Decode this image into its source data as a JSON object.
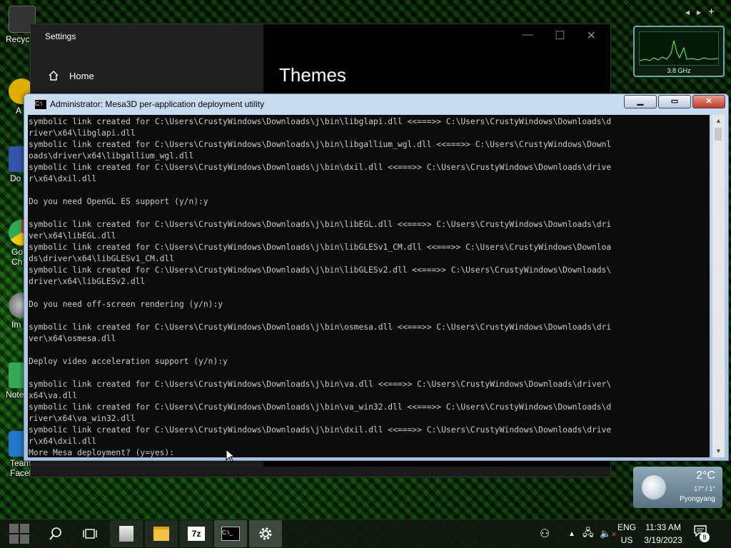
{
  "desktop": {
    "icons": [
      {
        "label": "Recyc",
        "color": "#2c2c2c"
      },
      {
        "label": "A",
        "color": "#e0b000"
      },
      {
        "label": "Do",
        "color": "#3355aa"
      },
      {
        "label": "Go\nCh",
        "color": "#dd3333"
      },
      {
        "label": "Im",
        "color": "#777777"
      },
      {
        "label": "Note",
        "color": "#33aa55"
      },
      {
        "label": "Team\nFacebo...",
        "color": "#2277cc"
      }
    ]
  },
  "cpu_gadget": {
    "label": "3.8 GHz"
  },
  "weather": {
    "temp": "2°C",
    "range": "17° / 1°",
    "city": "Pyongyang"
  },
  "settings": {
    "title": "Settings",
    "home_label": "Home",
    "page_title": "Themes"
  },
  "console": {
    "title": "Administrator:  Mesa3D per-application deployment utility",
    "lines": [
      "symbolic link created for C:\\Users\\CrustyWindows\\Downloads\\j\\bin\\libglapi.dll <<===>> C:\\Users\\CrustyWindows\\Downloads\\d",
      "river\\x64\\libglapi.dll",
      "symbolic link created for C:\\Users\\CrustyWindows\\Downloads\\j\\bin\\libgallium_wgl.dll <<===>> C:\\Users\\CrustyWindows\\Downl",
      "oads\\driver\\x64\\libgallium_wgl.dll",
      "symbolic link created for C:\\Users\\CrustyWindows\\Downloads\\j\\bin\\dxil.dll <<===>> C:\\Users\\CrustyWindows\\Downloads\\drive",
      "r\\x64\\dxil.dll",
      "",
      "Do you need OpenGL ES support (y/n):y",
      "",
      "symbolic link created for C:\\Users\\CrustyWindows\\Downloads\\j\\bin\\libEGL.dll <<===>> C:\\Users\\CrustyWindows\\Downloads\\dri",
      "ver\\x64\\libEGL.dll",
      "symbolic link created for C:\\Users\\CrustyWindows\\Downloads\\j\\bin\\libGLESv1_CM.dll <<===>> C:\\Users\\CrustyWindows\\Downloa",
      "ds\\driver\\x64\\libGLESv1_CM.dll",
      "symbolic link created for C:\\Users\\CrustyWindows\\Downloads\\j\\bin\\libGLESv2.dll <<===>> C:\\Users\\CrustyWindows\\Downloads\\",
      "driver\\x64\\libGLESv2.dll",
      "",
      "Do you need off-screen rendering (y/n):y",
      "",
      "symbolic link created for C:\\Users\\CrustyWindows\\Downloads\\j\\bin\\osmesa.dll <<===>> C:\\Users\\CrustyWindows\\Downloads\\dri",
      "ver\\x64\\osmesa.dll",
      "",
      "Deploy video acceleration support (y/n):y",
      "",
      "symbolic link created for C:\\Users\\CrustyWindows\\Downloads\\j\\bin\\va.dll <<===>> C:\\Users\\CrustyWindows\\Downloads\\driver\\",
      "x64\\va.dll",
      "symbolic link created for C:\\Users\\CrustyWindows\\Downloads\\j\\bin\\va_win32.dll <<===>> C:\\Users\\CrustyWindows\\Downloads\\d",
      "river\\x64\\va_win32.dll",
      "symbolic link created for C:\\Users\\CrustyWindows\\Downloads\\j\\bin\\dxil.dll <<===>> C:\\Users\\CrustyWindows\\Downloads\\drive",
      "r\\x64\\dxil.dll",
      "More Mesa deployment? (y=yes): "
    ]
  },
  "taskbar": {
    "apps": [
      {
        "name": "task-view",
        "icon": "task-view-icon"
      },
      {
        "name": "generic",
        "icon": "document-icon"
      },
      {
        "name": "file-explorer",
        "icon": "folder-icon"
      },
      {
        "name": "7zip",
        "icon": "7z-icon",
        "label": "7z"
      },
      {
        "name": "command-prompt",
        "icon": "console-icon"
      },
      {
        "name": "settings",
        "icon": "gear-icon"
      }
    ],
    "lang_top": "ENG",
    "lang_bottom": "US",
    "time": "11:33 AM",
    "date": "3/19/2023",
    "notification_count": "8"
  }
}
